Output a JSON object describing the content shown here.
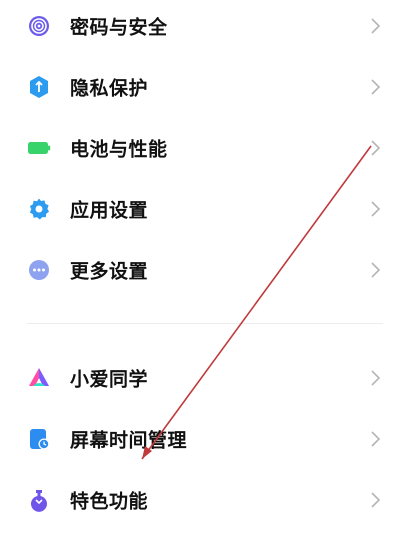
{
  "settings_group_1": [
    {
      "label": "密码与安全",
      "icon": "fingerprint-icon",
      "color": "#6b5be8"
    },
    {
      "label": "隐私保护",
      "icon": "privacy-shield-icon",
      "color": "#2d9cf0"
    },
    {
      "label": "电池与性能",
      "icon": "battery-icon",
      "color": "#38d36a"
    },
    {
      "label": "应用设置",
      "icon": "gear-icon",
      "color": "#2d9cf0"
    },
    {
      "label": "更多设置",
      "icon": "more-dots-icon",
      "color": "#8ea2f0"
    }
  ],
  "settings_group_2": [
    {
      "label": "小爱同学",
      "icon": "xiaoai-icon",
      "color": "#7a5cff"
    },
    {
      "label": "屏幕时间管理",
      "icon": "screen-time-icon",
      "color": "#2d8cf0"
    },
    {
      "label": "特色功能",
      "icon": "special-features-icon",
      "color": "#6f56e8"
    }
  ],
  "annotation": {
    "arrow_color": "#c0393b"
  }
}
